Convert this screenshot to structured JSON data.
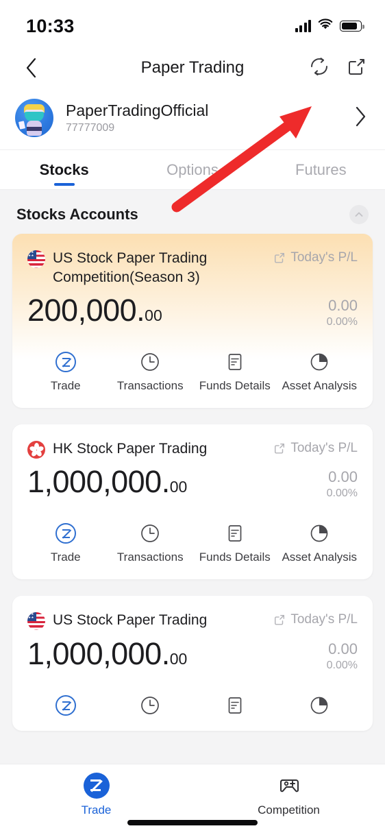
{
  "status_bar": {
    "time": "10:33",
    "signal_icon": "cellular-signal-icon",
    "wifi_icon": "wifi-icon",
    "battery_icon": "battery-icon"
  },
  "header": {
    "back_icon": "chevron-left-icon",
    "title": "Paper Trading",
    "refresh_icon": "refresh-icon",
    "share_icon": "share-icon"
  },
  "profile": {
    "name": "PaperTradingOfficial",
    "account_id": "77777009",
    "avatar_icon": "user-avatar",
    "chevron_icon": "chevron-right-icon"
  },
  "tabs": [
    {
      "label": "Stocks",
      "active": true
    },
    {
      "label": "Options",
      "active": false
    },
    {
      "label": "Futures",
      "active": false
    }
  ],
  "section": {
    "title": "Stocks Accounts",
    "collapse_icon": "chevron-up-icon"
  },
  "accounts": [
    {
      "flag": "us-flag-icon",
      "name": "US Stock Paper Trading Competition(Season 3)",
      "pl_label": "Today's P/L",
      "pl_icon": "share-box-icon",
      "balance_int": "200,000.",
      "balance_dec": "00",
      "pl_amount": "0.00",
      "pl_percent": "0.00%",
      "highlight": true,
      "actions": [
        {
          "label": "Trade",
          "icon": "trade-icon"
        },
        {
          "label": "Transactions",
          "icon": "clock-icon"
        },
        {
          "label": "Funds Details",
          "icon": "document-icon"
        },
        {
          "label": "Asset Analysis",
          "icon": "pie-chart-icon"
        }
      ]
    },
    {
      "flag": "hk-flag-icon",
      "name": "HK Stock Paper Trading",
      "pl_label": "Today's P/L",
      "pl_icon": "share-box-icon",
      "balance_int": "1,000,000.",
      "balance_dec": "00",
      "pl_amount": "0.00",
      "pl_percent": "0.00%",
      "highlight": false,
      "actions": [
        {
          "label": "Trade",
          "icon": "trade-icon"
        },
        {
          "label": "Transactions",
          "icon": "clock-icon"
        },
        {
          "label": "Funds Details",
          "icon": "document-icon"
        },
        {
          "label": "Asset Analysis",
          "icon": "pie-chart-icon"
        }
      ]
    },
    {
      "flag": "us-flag-icon",
      "name": "US Stock Paper Trading",
      "pl_label": "Today's P/L",
      "pl_icon": "share-box-icon",
      "balance_int": "1,000,000.",
      "balance_dec": "00",
      "pl_amount": "0.00",
      "pl_percent": "0.00%",
      "highlight": false,
      "actions": [
        {
          "label": "",
          "icon": "trade-icon"
        },
        {
          "label": "",
          "icon": "clock-icon"
        },
        {
          "label": "",
          "icon": "document-icon"
        },
        {
          "label": "",
          "icon": "pie-chart-icon"
        }
      ]
    }
  ],
  "bottom_tabs": [
    {
      "label": "Trade",
      "icon": "trade-filled-icon",
      "active": true
    },
    {
      "label": "Competition",
      "icon": "gamepad-plus-icon",
      "active": false
    }
  ],
  "annotation": {
    "type": "arrow",
    "color": "#ee2b2b",
    "points_to": "profile-chevron"
  },
  "colors": {
    "accent": "#1a62d8",
    "highlight_card": "#fcdfb2",
    "muted_text": "#a6a6ac",
    "page_bg": "#f4f4f5"
  }
}
